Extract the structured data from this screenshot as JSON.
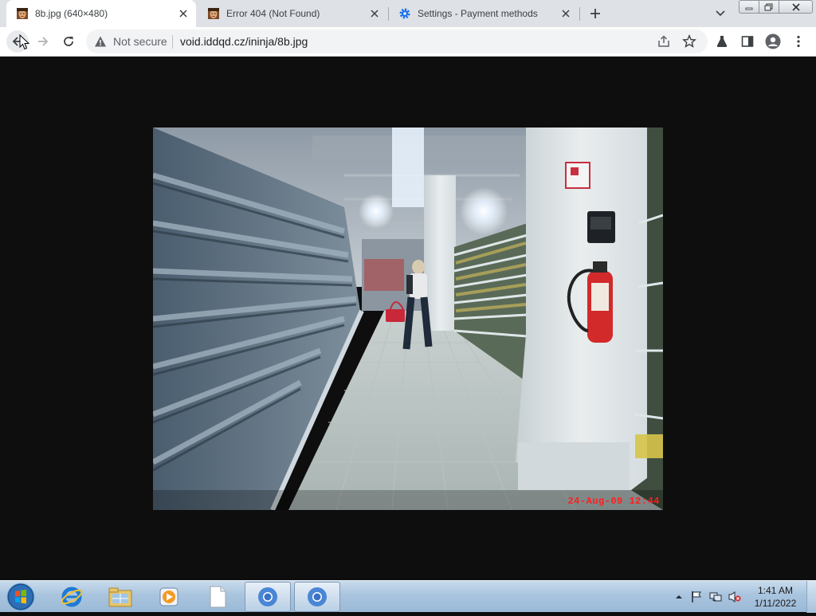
{
  "tabs": [
    {
      "title": "8b.jpg (640×480)",
      "icon": "face-thumbnail-icon",
      "active": true
    },
    {
      "title": "Error 404 (Not Found)",
      "icon": "face-thumbnail-icon",
      "active": false
    },
    {
      "title": "Settings - Payment methods",
      "icon": "settings-gear-icon",
      "active": false
    }
  ],
  "toolbar": {
    "security_label": "Not secure",
    "url": "void.iddqd.cz/ininja/8b.jpg"
  },
  "photo": {
    "timestamp": "24-Aug-09 12:44",
    "description_icon": "supermarket-aisle-photo"
  },
  "taskbar": {
    "items": [
      "internet-explorer-icon",
      "file-explorer-icon",
      "media-player-icon",
      "blank-document-icon",
      "chrome-icon",
      "chrome-icon"
    ],
    "clock_time": "1:41 AM",
    "clock_date": "1/11/2022"
  },
  "colors": {
    "accent": "#1a73e8",
    "timestamp": "#ff1e1e",
    "tabstrip": "#dee1e6"
  }
}
